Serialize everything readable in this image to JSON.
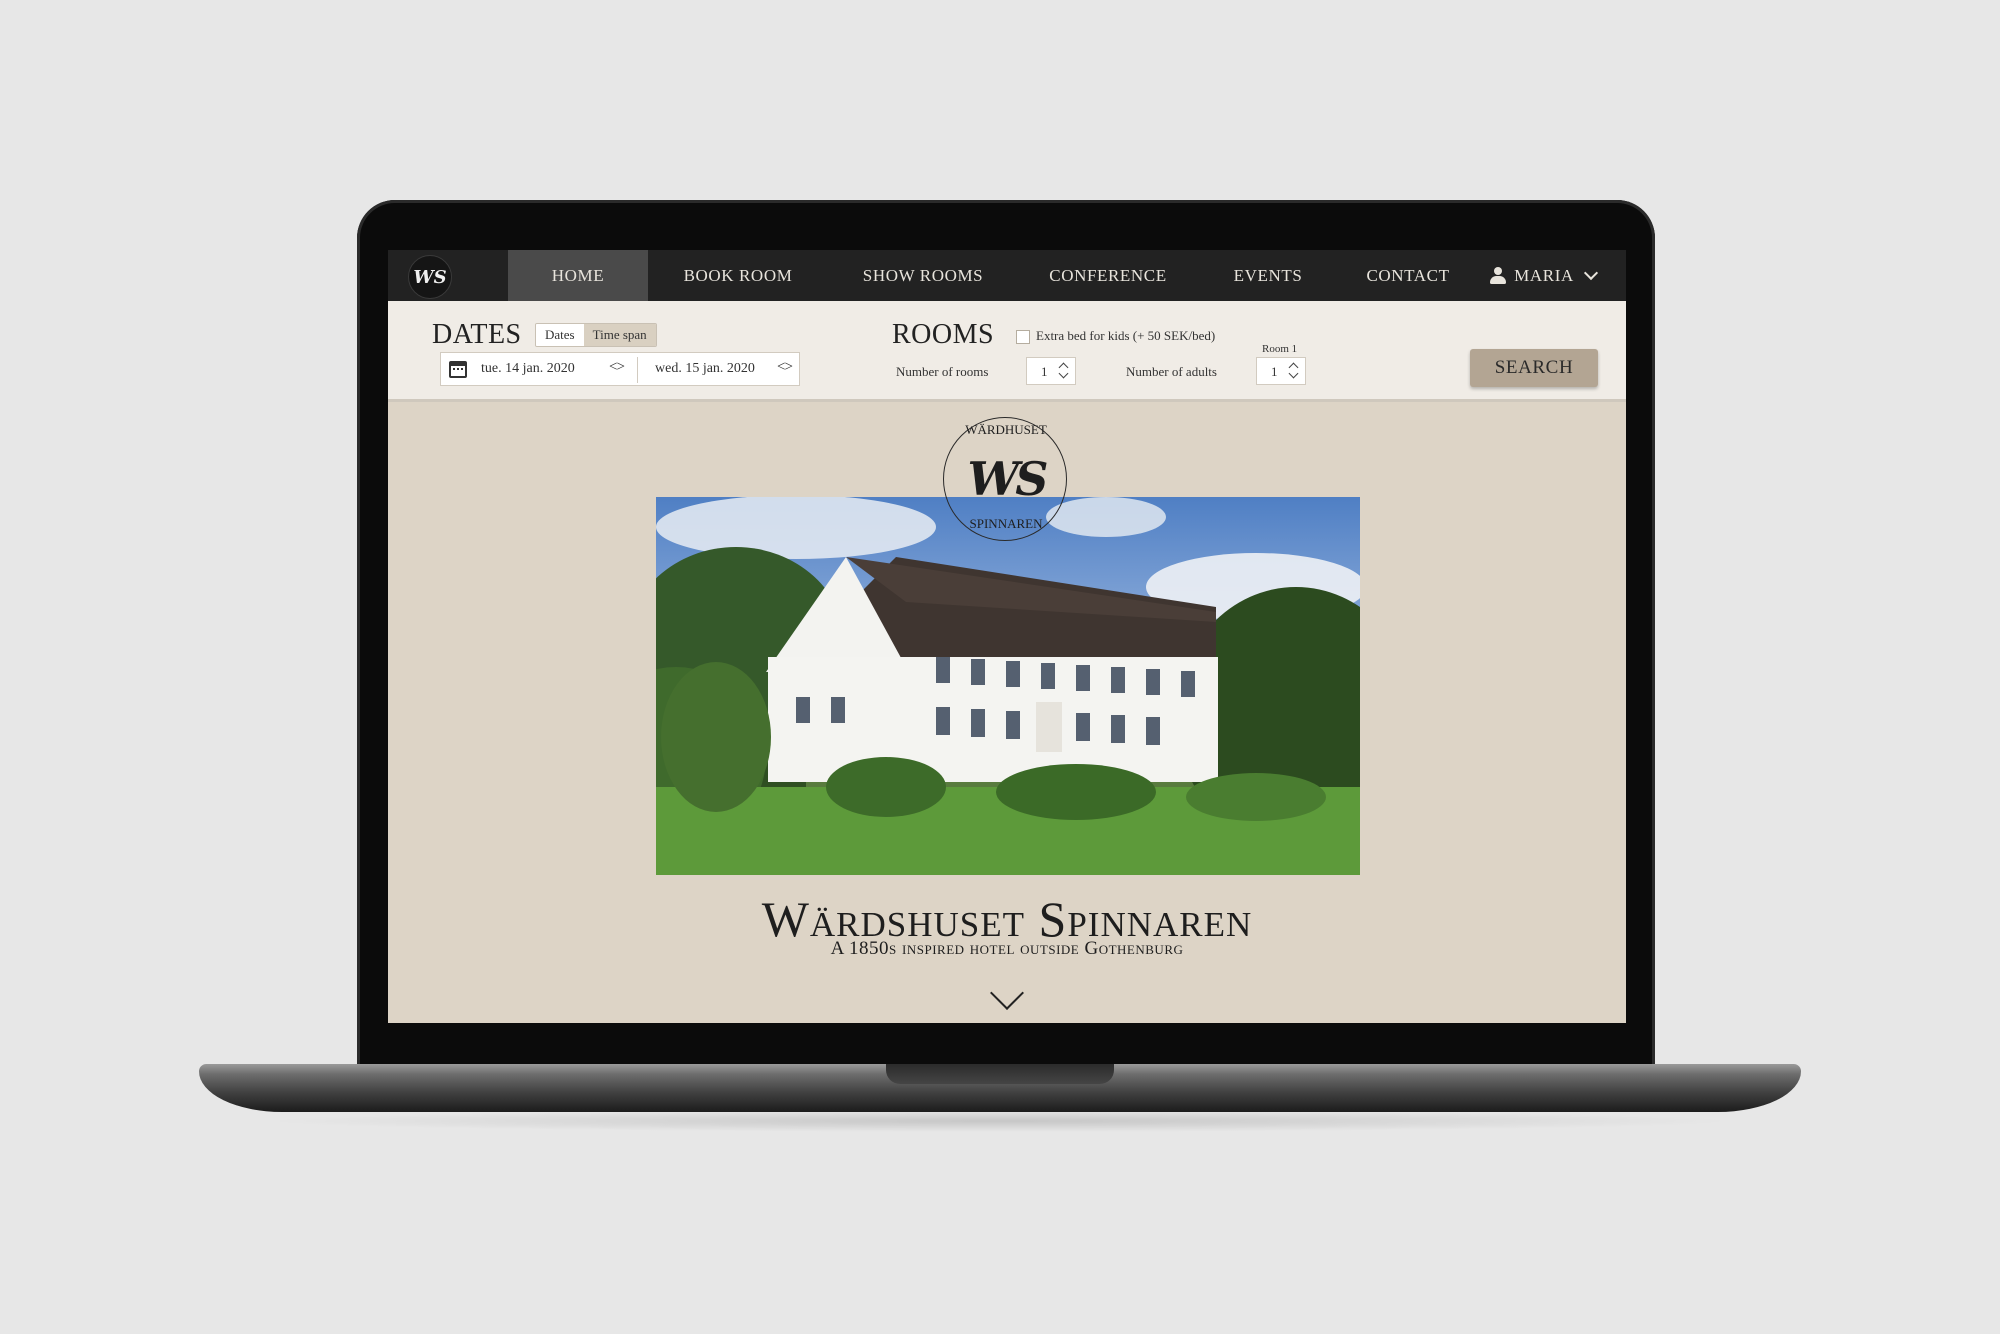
{
  "nav": {
    "logo_text": "WS",
    "items": [
      {
        "label": "HOME"
      },
      {
        "label": "BOOK ROOM"
      },
      {
        "label": "SHOW ROOMS"
      },
      {
        "label": "CONFERENCE"
      },
      {
        "label": "EVENTS"
      },
      {
        "label": "CONTACT"
      }
    ],
    "active_index": 0,
    "user_label": "MARIA"
  },
  "booking": {
    "dates_title": "DATES",
    "toggle": {
      "options": [
        "Dates",
        "Time span"
      ],
      "selected": "Dates"
    },
    "date_from": "tue. 14 jan. 2020",
    "date_to": "wed. 15 jan. 2020",
    "rooms_title": "ROOMS",
    "extra_bed_label": "Extra bed for kids (+ 50 SEK/bed)",
    "extra_bed_checked": false,
    "rooms_label": "Number of rooms",
    "rooms_value": "1",
    "adults_label": "Number of adults",
    "room_label": "Room 1",
    "adults_value": "1",
    "search_label": "SEARCH"
  },
  "hero": {
    "logo_mark": "WS",
    "logo_top_text": "WÄRDHUSET",
    "logo_bottom_text": "SPINNAREN",
    "title": "Wärdshuset Spinnaren",
    "subtitle": "A 1850s inspired hotel outside Gothenburg"
  },
  "colors": {
    "nav_bg": "#222222",
    "nav_active": "#4a4a4a",
    "booking_bg": "#f0ece6",
    "page_bg": "#ddd4c6",
    "button": "#b3a593"
  }
}
